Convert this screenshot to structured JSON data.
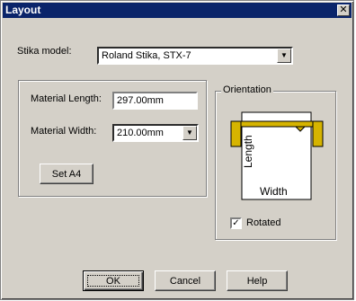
{
  "window": {
    "title": "Layout",
    "close_symbol": "✕"
  },
  "model": {
    "label": "Stika model:",
    "value": "Roland Stika, STX-7",
    "arrow": "▼"
  },
  "material": {
    "length_label": "Material Length:",
    "length_value": "297.00mm",
    "width_label": "Material Width:",
    "width_value": "210.00mm",
    "width_arrow": "▼",
    "set_a4_label": "Set A4"
  },
  "orientation": {
    "title": "Orientation",
    "preview_length_label": "Length",
    "preview_width_label": "Width",
    "rotated_label": "Rotated",
    "rotated_checked": true,
    "check_mark": "✓"
  },
  "buttons": {
    "ok": "OK",
    "cancel": "Cancel",
    "help": "Help"
  },
  "colors": {
    "title_bar": "#0a246a",
    "cutter_body": "#d6b400",
    "face": "#d4d0c8"
  }
}
